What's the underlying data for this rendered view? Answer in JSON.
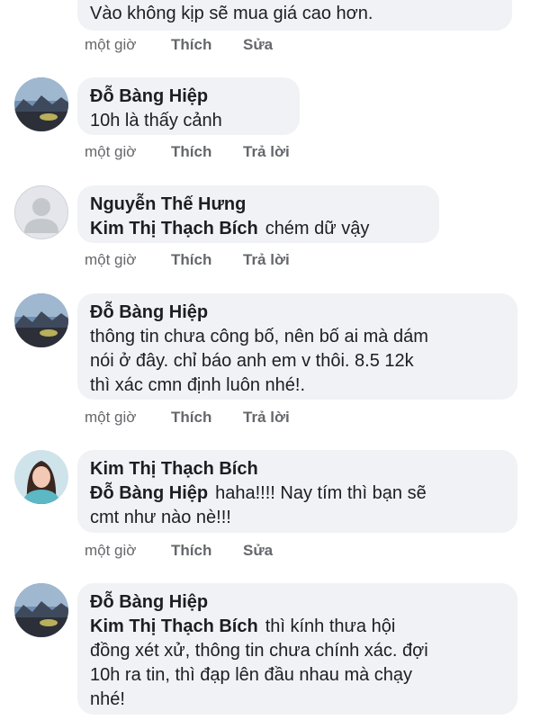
{
  "comments": [
    {
      "author": "",
      "text": "Vào không kịp sẽ mua giá cao hơn.",
      "time": "một giờ",
      "like": "Thích",
      "action": "Sửa"
    },
    {
      "author": "Đỗ Bàng Hiệp",
      "text": "10h là thấy cảnh",
      "time": "một giờ",
      "like": "Thích",
      "action": "Trả lời"
    },
    {
      "author": "Nguyễn Thế Hưng",
      "mention": "Kim Thị Thạch Bích",
      "text": "chém dữ vậy",
      "time": "một giờ",
      "like": "Thích",
      "action": "Trả lời"
    },
    {
      "author": "Đỗ Bàng Hiệp",
      "text_lines": [
        "thông tin chưa công bố, nên bố ai mà dám",
        "nói ở đây. chỉ báo anh em v thôi. 8.5 12k",
        "thì xác cmn định luôn nhé!."
      ],
      "time": "một giờ",
      "like": "Thích",
      "action": "Trả lời"
    },
    {
      "author": "Kim Thị Thạch Bích",
      "mention": "Đỗ Bàng Hiệp",
      "text_lines": [
        "haha!!!! Nay tím thì bạn sẽ",
        "cmt như nào nè!!!"
      ],
      "time": "một giờ",
      "like": "Thích",
      "action": "Sửa"
    },
    {
      "author": "Đỗ Bàng Hiệp",
      "mention": "Kim Thị Thạch Bích",
      "text_lines": [
        "thì kính thưa hội",
        "đồng xét xử, thông tin chưa chính xác. đợi",
        "10h ra tin, thì đạp lên đầu nhau mà chạy",
        "nhé!"
      ]
    }
  ],
  "avatars": {
    "landscape": "landscape-photo-avatar",
    "default": "default-user-avatar",
    "person": "woman-photo-avatar"
  },
  "colors": {
    "bubble_bg": "#f0f2f5",
    "meta_text": "#65676b",
    "text": "#1c1e21"
  }
}
